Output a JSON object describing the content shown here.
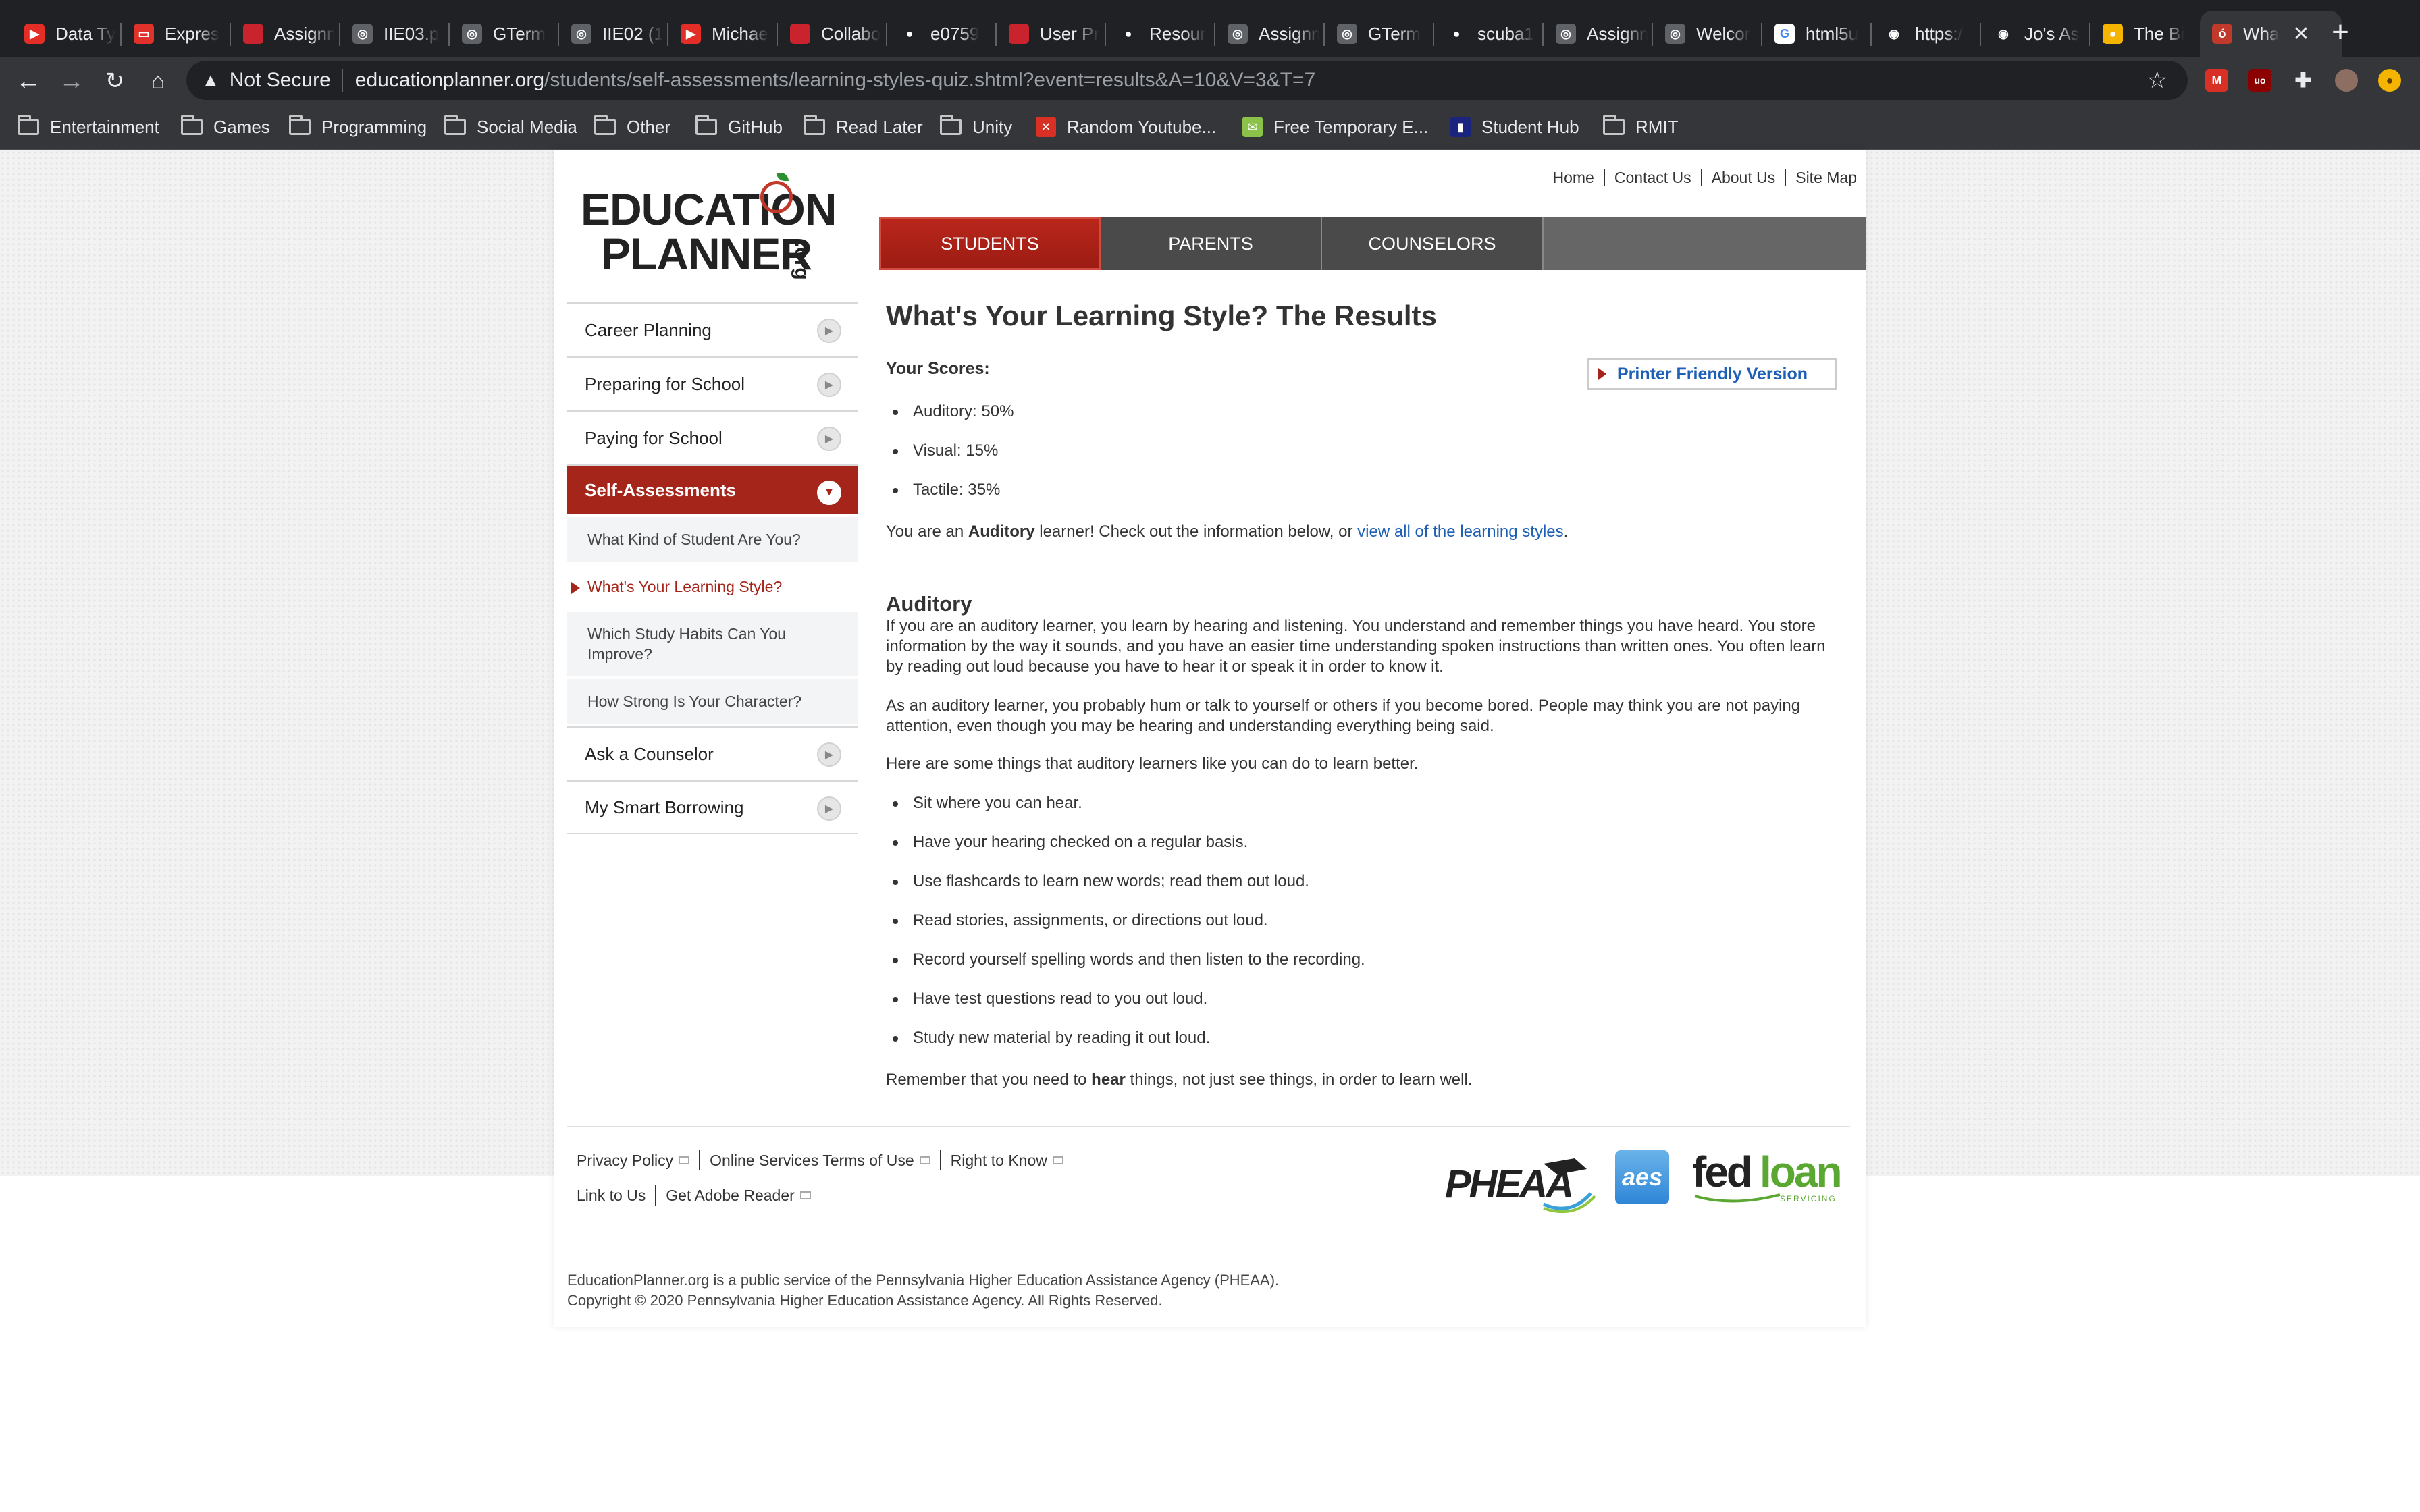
{
  "browser": {
    "tabs": [
      {
        "title": "Data Ty",
        "color": "#e52d27",
        "glyph": "▶"
      },
      {
        "title": "Expres",
        "color": "#e0322b",
        "glyph": "▭"
      },
      {
        "title": "Assignm",
        "color": "#c9232d",
        "glyph": ""
      },
      {
        "title": "IIE03.p",
        "color": "#5f6368",
        "glyph": "◎"
      },
      {
        "title": "GTerm",
        "color": "#5f6368",
        "glyph": "◎"
      },
      {
        "title": "IIE02 (1",
        "color": "#5f6368",
        "glyph": "◎"
      },
      {
        "title": "Michae",
        "color": "#e52d27",
        "glyph": "▶"
      },
      {
        "title": "Collabo",
        "color": "#c9232d",
        "glyph": ""
      },
      {
        "title": "e0759",
        "color": "#202124",
        "glyph": "●"
      },
      {
        "title": "User Pr",
        "color": "#c9232d",
        "glyph": ""
      },
      {
        "title": "Resour",
        "color": "#202124",
        "glyph": "●"
      },
      {
        "title": "Assignm",
        "color": "#5f6368",
        "glyph": "◎"
      },
      {
        "title": "GTerm",
        "color": "#5f6368",
        "glyph": "◎"
      },
      {
        "title": "scuba1",
        "color": "#202124",
        "glyph": "●"
      },
      {
        "title": "Assignm",
        "color": "#5f6368",
        "glyph": "◎"
      },
      {
        "title": "Welcor",
        "color": "#5f6368",
        "glyph": "◎"
      },
      {
        "title": "html5u",
        "color": "#ffffff",
        "glyph": "G"
      },
      {
        "title": "https:/",
        "color": "#202124",
        "glyph": "◉"
      },
      {
        "title": "Jo's As",
        "color": "#202124",
        "glyph": "◉"
      },
      {
        "title": "The Bi",
        "color": "#f4b400",
        "glyph": "●"
      },
      {
        "title": "Wha",
        "color": "#c0392b",
        "glyph": "ó",
        "active": true
      }
    ],
    "address": {
      "warning": "Not Secure",
      "host": "educationplanner.org",
      "path": "/students/self-assessments/learning-styles-quiz.shtml?event=results&A=10&V=3&T=7"
    },
    "bookmarks": [
      {
        "label": "Entertainment",
        "type": "folder"
      },
      {
        "label": "Games",
        "type": "folder"
      },
      {
        "label": "Programming",
        "type": "folder"
      },
      {
        "label": "Social Media",
        "type": "folder"
      },
      {
        "label": "Other",
        "type": "folder"
      },
      {
        "label": "GitHub",
        "type": "folder"
      },
      {
        "label": "Read Later",
        "type": "folder"
      },
      {
        "label": "Unity",
        "type": "folder"
      },
      {
        "label": "Random Youtube...",
        "type": "site",
        "color": "#d93025",
        "glyph": "✕"
      },
      {
        "label": "Free Temporary E...",
        "type": "site",
        "color": "#8bc34a",
        "glyph": "✉"
      },
      {
        "label": "Student Hub",
        "type": "site",
        "color": "#1a237e",
        "glyph": "▮"
      },
      {
        "label": "RMIT",
        "type": "folder"
      }
    ]
  },
  "site": {
    "logo": {
      "line1": "EDUCATION",
      "line2": "PLANNER",
      "suffix": ".org"
    },
    "top_links": [
      "Home",
      "Contact Us",
      "About Us",
      "Site Map"
    ],
    "main_nav": [
      "STUDENTS",
      "PARENTS",
      "COUNSELORS"
    ],
    "sidebar": {
      "items": [
        {
          "label": "Career Planning"
        },
        {
          "label": "Preparing for School"
        },
        {
          "label": "Paying for School"
        },
        {
          "label": "Self-Assessments"
        }
      ],
      "subitems": [
        {
          "label": "What Kind of Student Are You?"
        },
        {
          "label": "What's Your Learning Style?"
        },
        {
          "label": "Which Study Habits Can You Improve?"
        },
        {
          "label": "How Strong Is Your Character?"
        }
      ],
      "items_after": [
        {
          "label": "Ask a Counselor"
        },
        {
          "label": "My Smart Borrowing"
        }
      ]
    },
    "content": {
      "title": "What's Your Learning Style? The Results",
      "scores_label": "Your Scores:",
      "printer_label": "Printer Friendly Version",
      "scores": [
        "Auditory: 50%",
        "Visual: 15%",
        "Tactile: 35%"
      ],
      "result_pre": "You are an ",
      "result_bold": "Auditory",
      "result_mid": " learner! Check out the information below, or ",
      "result_link": "view all of the learning styles",
      "result_end": ".",
      "section_title": "Auditory",
      "para1": "If you are an auditory learner, you learn by hearing and listening. You understand and remember things you have heard. You store information by the way it sounds, and you have an easier time understanding spoken instructions than written ones. You often learn by reading out loud because you have to hear it or speak it in order to know it.",
      "para2": "As an auditory learner, you probably hum or talk to yourself or others if you become bored. People may think you are not paying attention, even though you may be hearing and understanding everything being said.",
      "para3": "Here are some things that auditory learners like you can do to learn better.",
      "tips": [
        "Sit where you can hear.",
        "Have your hearing checked on a regular basis.",
        "Use flashcards to learn new words; read them out loud.",
        "Read stories, assignments, or directions out loud.",
        "Record yourself spelling words and then listen to the recording.",
        "Have test questions read to you out loud.",
        "Study new material by reading it out loud."
      ],
      "closing_pre": "Remember that you need to ",
      "closing_bold": "hear",
      "closing_post": " things, not just see things, in order to learn well."
    },
    "footer": {
      "links_row1": [
        "Privacy Policy",
        "Online Services Terms of Use",
        "Right to Know"
      ],
      "links_row2": [
        "Link to Us",
        "Get Adobe Reader"
      ],
      "logos": {
        "pheaa": "PHEAA",
        "aes": "aes",
        "fedloan": "fedloan",
        "fedloan_sub": "SERVICING"
      },
      "legal1": "EducationPlanner.org is a public service of the Pennsylvania Higher Education Assistance Agency (PHEAA).",
      "legal2": "Copyright © 2020 Pennsylvania Higher Education Assistance Agency. All Rights Reserved."
    }
  }
}
